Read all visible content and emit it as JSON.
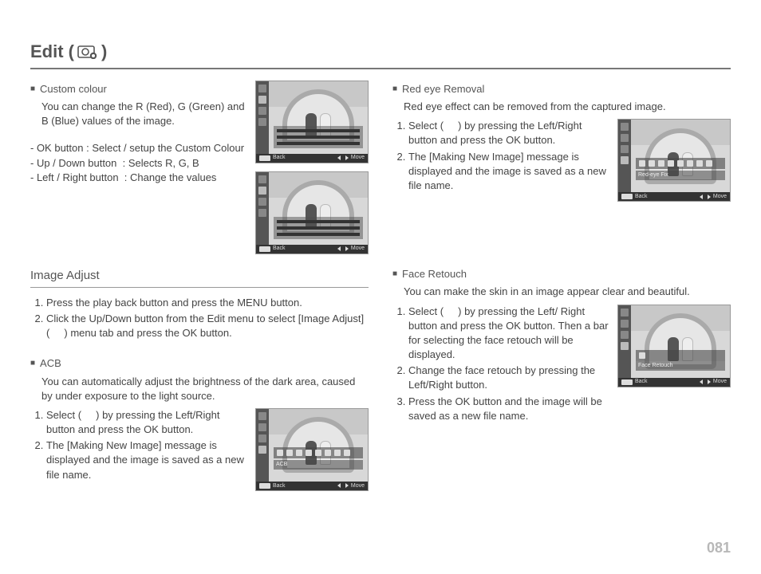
{
  "title": {
    "pre": "Edit (",
    "post": ")"
  },
  "col1": {
    "custom_colour": {
      "head": "Custom colour",
      "desc": "You can change the R (Red), G (Green) and B (Blue) values of the image.",
      "lines": [
        "- OK button : Select / setup the Custom Colour",
        "- Up / Down button  : Selects R, G, B",
        "- Left / Right button  : Change the values"
      ]
    },
    "image_adjust": {
      "head": "Image Adjust",
      "steps": [
        "Press the play back button and press the MENU button.",
        "Click the Up/Down button from the Edit menu to select [Image Adjust] (     ) menu tab and press the OK button."
      ]
    },
    "acb": {
      "head": "ACB",
      "desc": "You can automatically adjust the brightness of the dark area, caused by under exposure to the light source.",
      "steps": [
        "Select (     ) by pressing the Left/Right button and press the OK button.",
        "The [Making New Image] message is displayed and the image is saved as a new file name."
      ],
      "strip": "ACB"
    }
  },
  "col2": {
    "redeye": {
      "head": "Red eye Removal",
      "desc": "Red eye effect can be removed from the captured image.",
      "steps": [
        "Select (     ) by pressing the Left/Right button and press the OK button.",
        "The [Making New Image] message is displayed and the image is saved as a new file name."
      ],
      "strip": "Red-eye Fix"
    },
    "face": {
      "head": "Face Retouch",
      "desc": "You can make the skin in an image appear clear and beautiful.",
      "steps": [
        "Select (     ) by pressing the Left/ Right button and press the OK button. Then a bar for selecting the face retouch will be displayed.",
        "Change the face retouch by pressing the Left/Right button.",
        "Press the OK button and the image will be saved as a new file name."
      ],
      "strip": "Face Retouch"
    }
  },
  "footer": {
    "back": "Back",
    "move": "Move"
  },
  "page_number": "081"
}
